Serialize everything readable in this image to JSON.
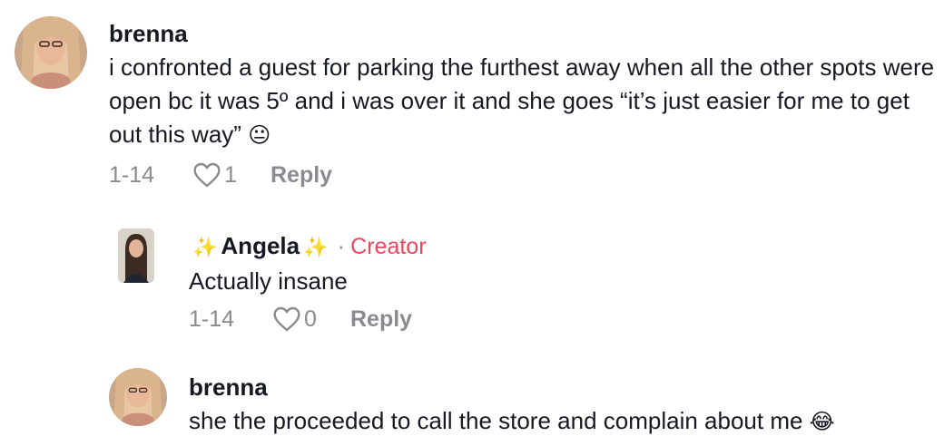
{
  "comments": [
    {
      "username": "brenna",
      "text": "i confronted a guest for parking the furthest away when all the other spots were open bc it was 5º and i was over it and she goes “it’s just easier for me to get out this way”",
      "emoji": "😐",
      "date": "1-14",
      "likes": "1",
      "reply_label": "Reply"
    },
    {
      "username": "Angela",
      "sparkle_left": "✨",
      "sparkle_right": "✨",
      "separator": "·",
      "badge": "Creator",
      "badge_color": "#e8485f",
      "text": "Actually insane",
      "date": "1-14",
      "likes": "0",
      "reply_label": "Reply"
    },
    {
      "username": "brenna",
      "text": "she the proceeded to call the store and complain about me",
      "emoji": "😂"
    }
  ]
}
